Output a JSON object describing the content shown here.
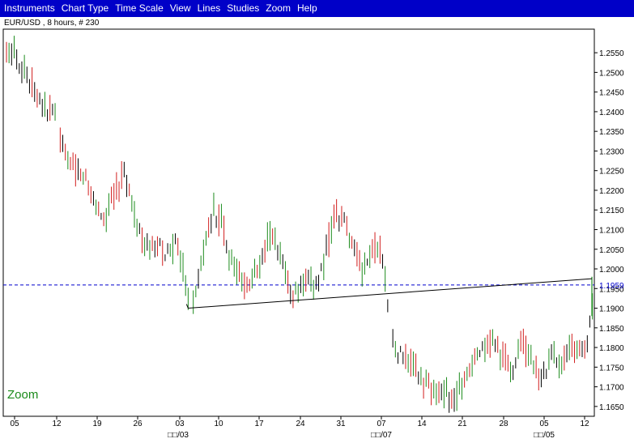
{
  "menu": [
    "Instruments",
    "Chart Type",
    "Time Scale",
    "View",
    "Lines",
    "Studies",
    "Zoom",
    "Help"
  ],
  "chart_title": "EUR/USD , 8 hours, # 230",
  "zoom_label": "Zoom",
  "colors": {
    "menu_bg": "#0000c8",
    "up": "#1e8c1e",
    "down": "#d21e1e",
    "neutral": "#000000",
    "current_price_line": "#0000cc",
    "trendline": "#000000"
  },
  "chart_data": {
    "type": "ohlc",
    "title": "EUR/USD , 8 hours, # 230",
    "current_price": 1.1959,
    "current_price_label": "1.1959",
    "ylim": [
      1.1625,
      1.261
    ],
    "y_ticks": [
      "1.1650",
      "1.1700",
      "1.1750",
      "1.1800",
      "1.1850",
      "1.1900",
      "1.1950",
      "1.2000",
      "1.2050",
      "1.2100",
      "1.2150",
      "1.2200",
      "1.2250",
      "1.2300",
      "1.2350",
      "1.2400",
      "1.2450",
      "1.2500",
      "1.2550"
    ],
    "x_tick_labels": [
      "05",
      "12",
      "19",
      "26",
      "03",
      "10",
      "17",
      "24",
      "31",
      "07",
      "14",
      "21",
      "28",
      "05",
      "12"
    ],
    "x_month_labels": [
      "/03",
      "/07",
      "/05"
    ],
    "trendline": {
      "from_bar": 71,
      "from_value": 1.19,
      "to_bar": 230,
      "to_value": 1.1975
    },
    "bar_count": 230
  }
}
